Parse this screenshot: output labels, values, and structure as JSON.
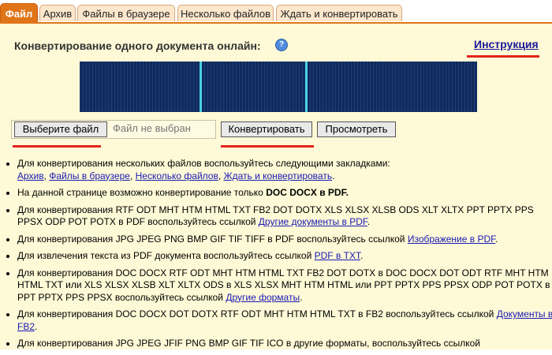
{
  "tabs": [
    {
      "label": "Файл",
      "active": true
    },
    {
      "label": "Архив",
      "active": false
    },
    {
      "label": "Файлы в браузере",
      "active": false
    },
    {
      "label": "Несколько файлов",
      "active": false
    },
    {
      "label": "Ждать и конвертировать",
      "active": false
    }
  ],
  "heading": "Конвертирование одного документа онлайн:",
  "help_icon": "?",
  "instruction_link": "Инструкция",
  "choose_file_button": "Выберите файл",
  "file_status": "Файл не выбран",
  "convert_button": "Конвертировать",
  "view_button": "Просмотреть",
  "info": [
    {
      "text": "Для конвертирования нескольких файлов воспользуйтесь следующими закладками:",
      "links": [
        "Архив",
        "Файлы в браузере",
        "Несколько файлов",
        "Ждать и конвертировать"
      ]
    },
    {
      "text": "На данной странице возможно конвертирование только ",
      "bold": "DOC DOCX в PDF."
    },
    {
      "text": "Для конвертирования RTF ODT MHT HTM HTML TXT FB2 DOT DOTX XLS XLSX XLSB ODS XLT XLTX PPT PPTX PPS PPSX ODP POT POTX в PDF воспользуйтесь ссылкой ",
      "link": "Другие документы в PDF"
    },
    {
      "text": "Для конвертирования JPG JPEG PNG BMP GIF TIF TIFF в PDF воспользуйтесь ссылкой ",
      "link": "Изображение в PDF"
    },
    {
      "text": "Для извлечения текста из PDF документа воспользуйтесь ссылкой ",
      "link": "PDF в TXT"
    },
    {
      "text": "Для конвертирования DOC DOCX RTF ODT MHT HTM HTML TXT FB2 DOT DOTX в DOC DOCX DOT ODT RTF MHT HTM HTML TXT или XLS XLSX XLSB XLT XLTX ODS в XLS XLSX MHT HTM HTML или PPT PPTX PPS PPSX ODP POT POTX в PPT PPTX PPS PPSX воспользуйтесь ссылкой ",
      "link": "Другие форматы"
    },
    {
      "text": "Для конвертирования DOC DOCX DOT DOTX RTF ODT MHT HTM HTML TXT в FB2 воспользуйтесь ссылкой ",
      "link": "Документы в FB2"
    },
    {
      "text": "Для конвертирования JPG JPEG JFIF PNG BMP GIF TIF ICO в другие форматы, воспользуйтесь ссылкой"
    }
  ],
  "colors": {
    "accent": "#e07518",
    "panel_bg": "#fef9d6",
    "tab_bg": "#fce7cc",
    "highlight": "#e2231a",
    "banner": "#122a5c",
    "link": "#1a1ab5"
  }
}
